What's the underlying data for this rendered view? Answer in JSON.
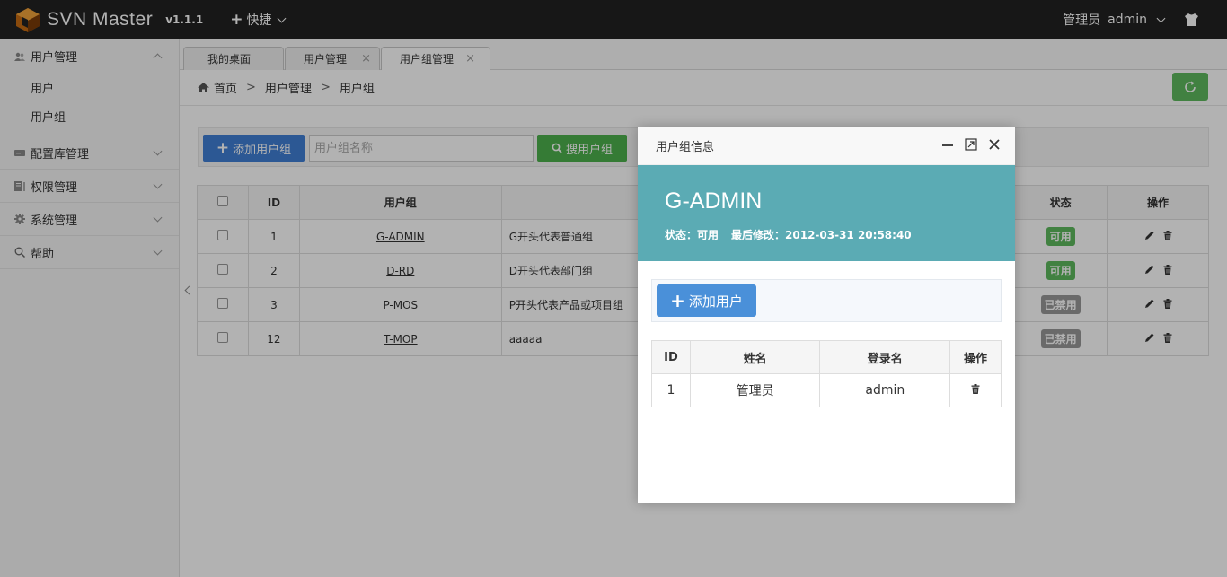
{
  "topbar": {
    "app_name": "SVN Master",
    "version": "v1.1.1",
    "quick_label": "快捷",
    "role": "管理员",
    "username": "admin"
  },
  "sidebar": {
    "groups": [
      {
        "label": "用户管理",
        "icon": "users-icon",
        "expanded": true,
        "items": [
          "用户",
          "用户组"
        ]
      },
      {
        "label": "配置库管理",
        "icon": "drive-icon",
        "expanded": false
      },
      {
        "label": "权限管理",
        "icon": "book-icon",
        "expanded": false
      },
      {
        "label": "系统管理",
        "icon": "gear-icon",
        "expanded": false
      },
      {
        "label": "帮助",
        "icon": "search-icon",
        "expanded": false
      }
    ]
  },
  "tabs": [
    {
      "label": "我的桌面",
      "closable": false
    },
    {
      "label": "用户管理",
      "closable": true
    },
    {
      "label": "用户组管理",
      "closable": true,
      "active": true
    }
  ],
  "breadcrumb": {
    "home": "首页",
    "level1": "用户管理",
    "level2": "用户组"
  },
  "toolbar": {
    "add_group_label": "添加用户组",
    "search_placeholder": "用户组名称",
    "search_label": "搜用户组"
  },
  "grid": {
    "headers": {
      "id": "ID",
      "group": "用户组",
      "status": "状态",
      "actions": "操作"
    },
    "rows": [
      {
        "id": "1",
        "name": "G-ADMIN",
        "desc": "G开头代表普通组",
        "status": "可用",
        "status_type": "ok"
      },
      {
        "id": "2",
        "name": "D-RD",
        "desc": "D开头代表部门组",
        "status": "可用",
        "status_type": "ok"
      },
      {
        "id": "3",
        "name": "P-MOS",
        "desc": "P开头代表产品或项目组",
        "status": "已禁用",
        "status_type": "no"
      },
      {
        "id": "12",
        "name": "T-MOP",
        "desc": "aaaaa",
        "status": "已禁用",
        "status_type": "no"
      }
    ]
  },
  "modal": {
    "title": "用户组信息",
    "group_name": "G-ADMIN",
    "status_text": "状态：可用",
    "modified_text": "最后修改：2012-03-31 20:58:40",
    "add_user_label": "添加用户",
    "table": {
      "headers": {
        "id": "ID",
        "name": "姓名",
        "login": "登录名",
        "actions": "操作"
      },
      "rows": [
        {
          "id": "1",
          "name": "管理员",
          "login": "admin"
        }
      ]
    }
  },
  "colors": {
    "topbar": "#222222",
    "primary_blue": "#3f7fd5",
    "success_green": "#5eb95e",
    "modal_banner": "#5babb4",
    "disabled_gray": "#999999"
  }
}
